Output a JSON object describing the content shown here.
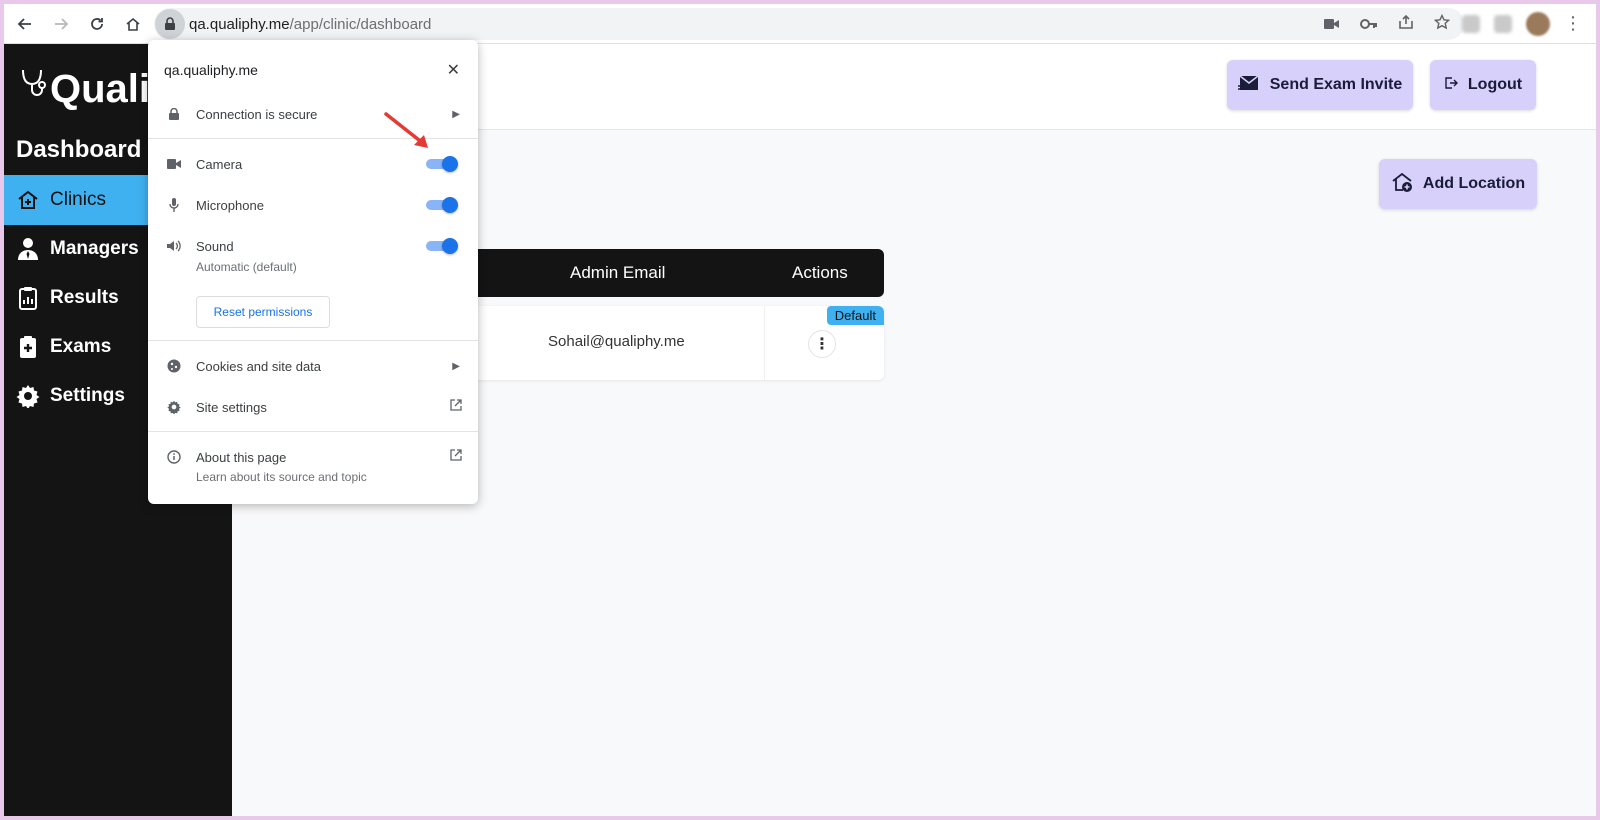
{
  "browser": {
    "url_host": "qa.qualiphy.me",
    "url_path": "/app/clinic/dashboard"
  },
  "sidebar": {
    "logo_text": "Quali",
    "title": "Dashboard",
    "items": [
      {
        "label": "Clinics",
        "icon": "home-plus-icon",
        "active": true
      },
      {
        "label": "Managers",
        "icon": "manager-icon",
        "active": false
      },
      {
        "label": "Results",
        "icon": "clipboard-chart-icon",
        "active": false
      },
      {
        "label": "Exams",
        "icon": "clipboard-plus-icon",
        "active": false
      },
      {
        "label": "Settings",
        "icon": "gear-icon",
        "active": false
      }
    ]
  },
  "header": {
    "send_invite_label": "Send Exam Invite",
    "logout_label": "Logout"
  },
  "main": {
    "add_location_label": "Add Location",
    "table": {
      "columns": [
        "Admin Email",
        "Actions"
      ],
      "rows": [
        {
          "admin_email": "Sohail@qualiphy.me",
          "badge": "Default"
        }
      ]
    }
  },
  "popup": {
    "site": "qa.qualiphy.me",
    "connection": "Connection is secure",
    "permissions": [
      {
        "label": "Camera",
        "enabled": true
      },
      {
        "label": "Microphone",
        "enabled": true
      },
      {
        "label": "Sound",
        "sub": "Automatic (default)",
        "enabled": true
      }
    ],
    "reset_label": "Reset permissions",
    "cookies_label": "Cookies and site data",
    "site_settings_label": "Site settings",
    "about_label": "About this page",
    "about_sub": "Learn about its source and topic"
  },
  "colors": {
    "accent_blue": "#3fb0f0",
    "button_purple": "#d6d0fb",
    "sidebar_bg": "#141414",
    "toggle_blue": "#1a73e8",
    "annotation_arrow": "#e53935"
  }
}
